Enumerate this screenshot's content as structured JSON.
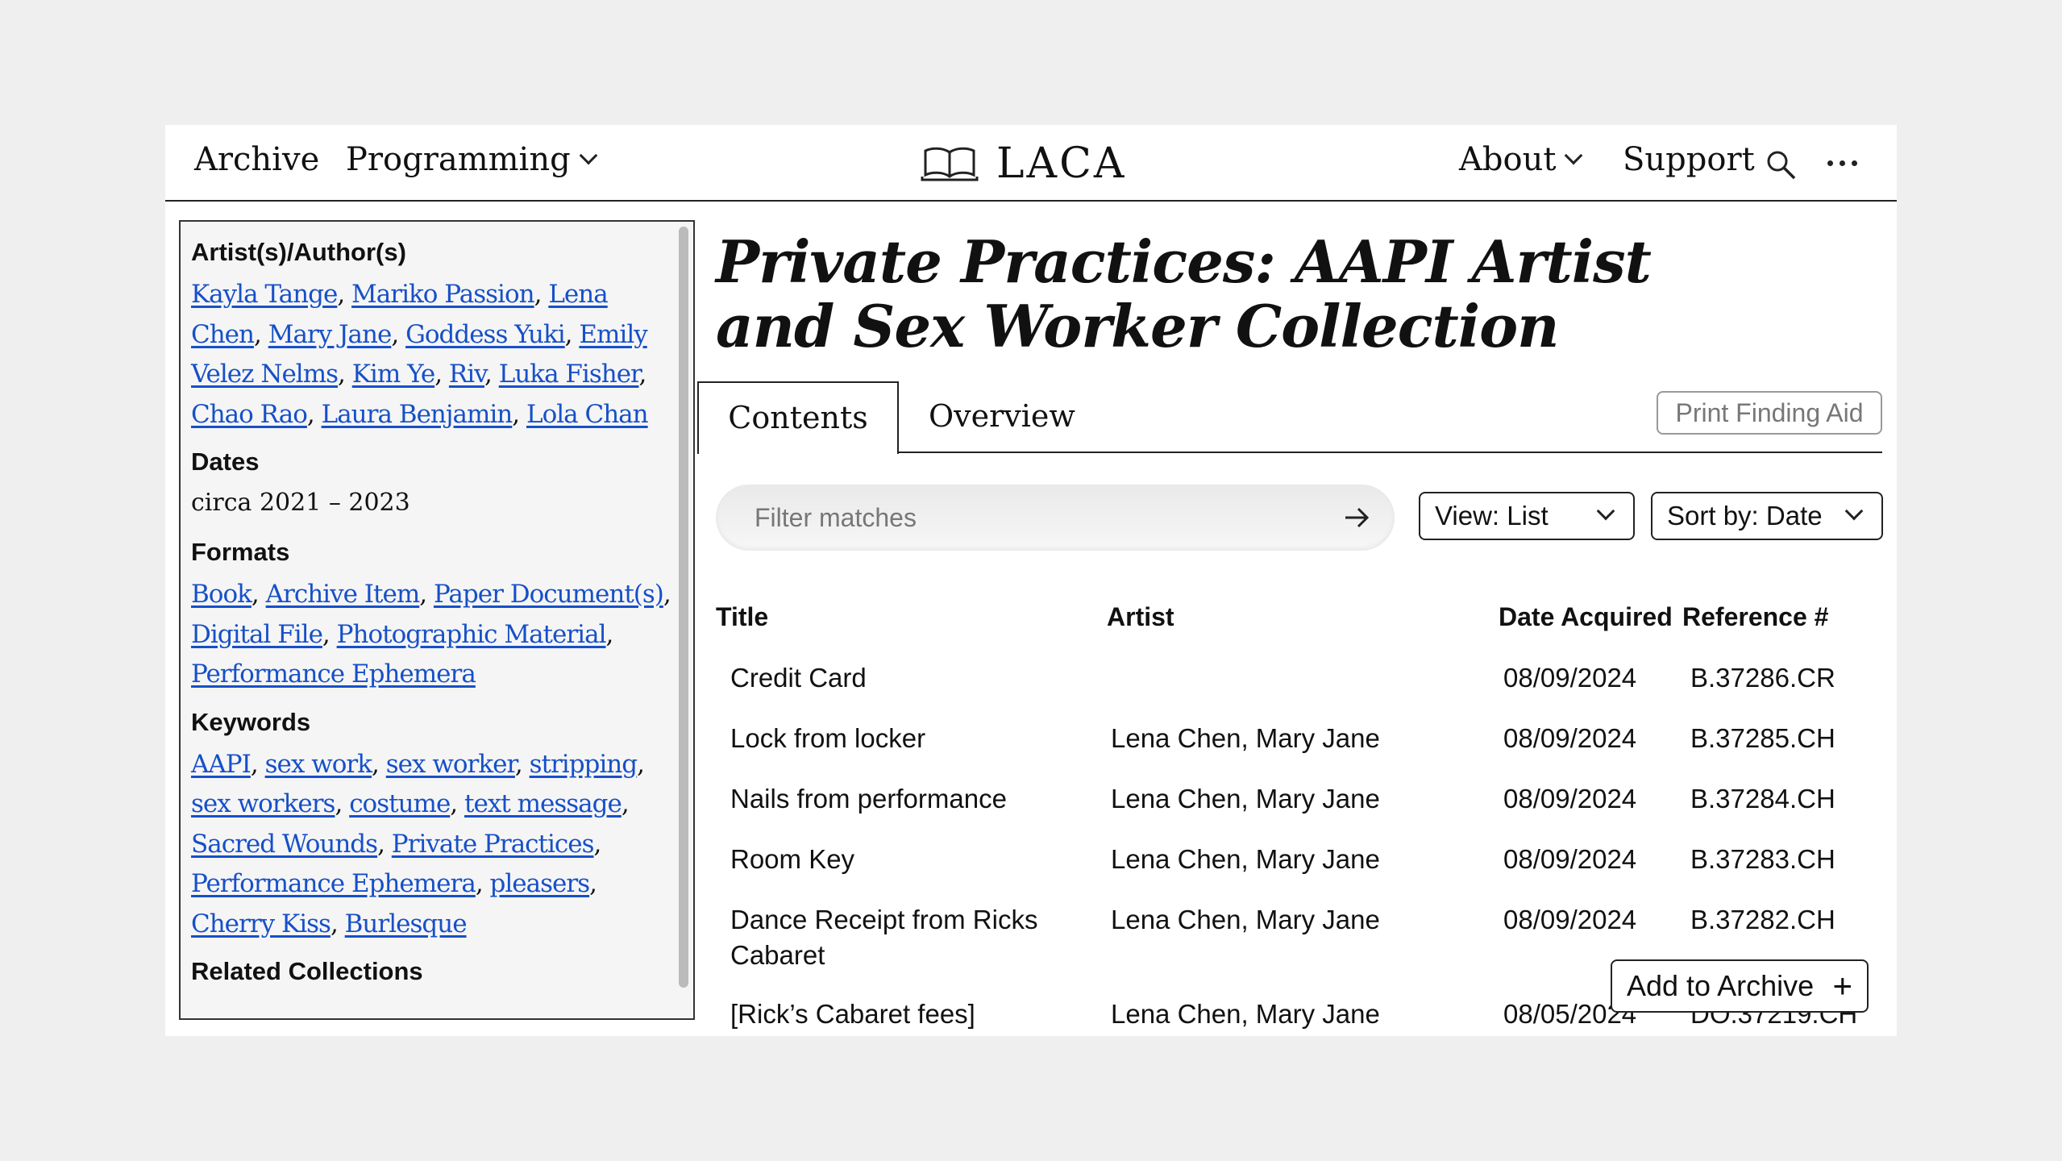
{
  "nav": {
    "archive": "Archive",
    "programming": "Programming",
    "logo_text": "LACA",
    "about": "About",
    "support": "Support"
  },
  "sidebar": {
    "artists_title": "Artist(s)/Author(s)",
    "artists": [
      "Kayla Tange",
      "Mariko Passion",
      "Lena Chen",
      "Mary Jane",
      "Goddess Yuki",
      "Emily Velez Nelms",
      "Kim Ye",
      "Riv",
      "Luka Fisher",
      "Chao Rao",
      "Laura Benjamin",
      "Lola Chan"
    ],
    "dates_title": "Dates",
    "dates_value": "circa 2021 – 2023",
    "formats_title": "Formats",
    "formats": [
      "Book",
      "Archive Item",
      "Paper Document(s)",
      "Digital File",
      "Photographic Material",
      "Performance Ephemera"
    ],
    "keywords_title": "Keywords",
    "keywords": [
      "AAPI",
      "sex work",
      "sex worker",
      "stripping",
      "sex workers",
      "costume",
      "text message",
      "Sacred Wounds",
      "Private Practices",
      "Performance Ephemera",
      "pleasers",
      "Cherry Kiss",
      "Burlesque"
    ],
    "related_title": "Related Collections"
  },
  "main": {
    "title": "Private Practices: AAPI Artist and Sex Worker Collection",
    "tabs": [
      {
        "label": "Contents"
      },
      {
        "label": "Overview"
      }
    ],
    "print_label": "Print Finding Aid",
    "filter_placeholder": "Filter matches",
    "view_select": "View: List",
    "sort_select": "Sort by: Date",
    "add_archive_label": "Add to Archive",
    "add_archive_plus": "+"
  },
  "table": {
    "headers": {
      "title": "Title",
      "artist": "Artist",
      "date": "Date Acquired",
      "ref": "Reference #"
    },
    "rows": [
      {
        "title": "Credit Card",
        "artist": "",
        "date": "08/09/2024",
        "ref": "B.37286.CR"
      },
      {
        "title": "Lock from locker",
        "artist": "Lena Chen, Mary Jane",
        "date": "08/09/2024",
        "ref": "B.37285.CH"
      },
      {
        "title": "Nails from performance",
        "artist": "Lena Chen, Mary Jane",
        "date": "08/09/2024",
        "ref": "B.37284.CH"
      },
      {
        "title": "Room Key",
        "artist": "Lena Chen, Mary Jane",
        "date": "08/09/2024",
        "ref": "B.37283.CH"
      },
      {
        "title": "Dance Receipt from Ricks Cabaret",
        "artist": "Lena Chen, Mary Jane",
        "date": "08/09/2024",
        "ref": "B.37282.CH"
      },
      {
        "title": "[Rick’s Cabaret fees]",
        "artist": "Lena Chen, Mary Jane",
        "date": "08/05/2024",
        "ref": "DO.37219.CH"
      }
    ]
  },
  "colors": {
    "link": "#1650c8",
    "border": "#222222",
    "sidebar_bg": "#f5f5f5"
  }
}
